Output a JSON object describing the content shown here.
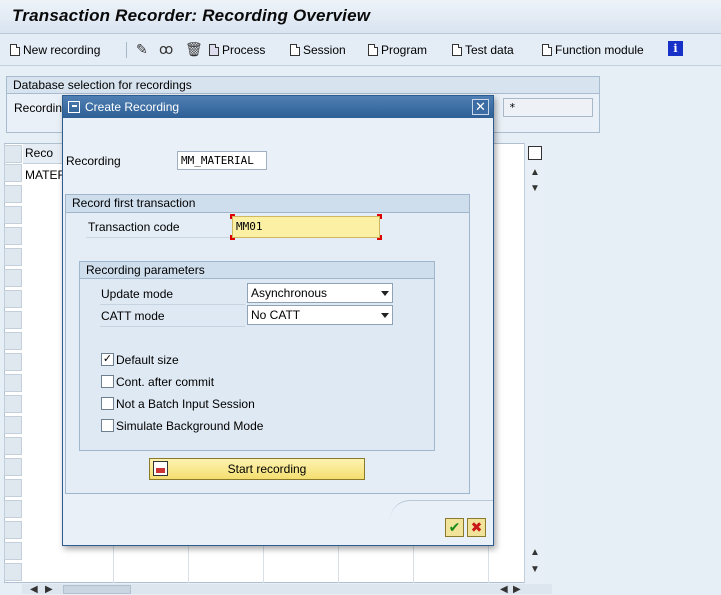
{
  "window": {
    "title": "Transaction Recorder: Recording Overview"
  },
  "toolbar": {
    "new_recording": "New recording",
    "process": "Process",
    "session": "Session",
    "program": "Program",
    "test_data": "Test data",
    "function_module": "Function module",
    "icons": [
      "document-icon",
      "pencil-icon",
      "glasses-icon",
      "trash-icon",
      "process-icon",
      "info-icon"
    ]
  },
  "db_selection": {
    "header": "Database selection for recordings",
    "recording_label": "Recordin",
    "input_value": "*"
  },
  "grid": {
    "column_header": "Reco",
    "first_cell": "MATER"
  },
  "dialog": {
    "title": "Create Recording",
    "recording_label": "Recording",
    "recording_value": "MM_MATERIAL",
    "first_transaction_header": "Record first transaction",
    "transaction_code_label": "Transaction code",
    "transaction_code_value": "MM01",
    "parameters_header": "Recording parameters",
    "update_mode_label": "Update mode",
    "update_mode_value": "Asynchronous",
    "catt_mode_label": "CATT mode",
    "catt_mode_value": "No CATT",
    "checkboxes": [
      {
        "label": "Default size",
        "checked": true
      },
      {
        "label": "Cont. after commit",
        "checked": false
      },
      {
        "label": "Not a Batch Input Session",
        "checked": false
      },
      {
        "label": "Simulate Background Mode",
        "checked": false
      }
    ],
    "start_button": "Start recording",
    "ok_glyph": "✔",
    "cancel_glyph": "✖",
    "close_glyph": "✕"
  },
  "colors": {
    "title_bar": "#2e5f95",
    "highlight_field": "#fbf0a4",
    "button_yellow": "#f4de70"
  }
}
